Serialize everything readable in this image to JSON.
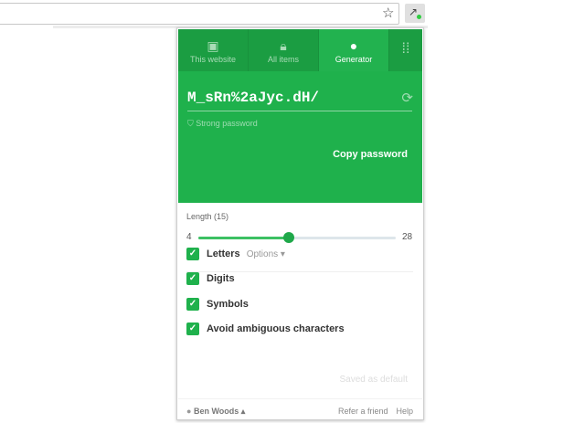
{
  "browser": {
    "bookmark_icon": "star-icon",
    "extension_icon": "password-manager-extension-icon"
  },
  "tabs": [
    {
      "label": "This website",
      "icon": "website-icon"
    },
    {
      "label": "All items",
      "icon": "lock-icon"
    },
    {
      "label": "Generator",
      "icon": "generator-icon",
      "active": true
    },
    {
      "label": "",
      "icon": "apps-grid-icon"
    }
  ],
  "generator": {
    "password": "M_sRn%2aJyc.dH/",
    "strength": "Strong password",
    "copy_label": "Copy password",
    "length_label": "Length (15)",
    "length": 15,
    "min": "4",
    "max": "28",
    "options": [
      {
        "label": "Letters",
        "checked": true,
        "extra": "Options ▾"
      },
      {
        "label": "Digits",
        "checked": true
      },
      {
        "label": "Symbols",
        "checked": true
      },
      {
        "label": "Avoid ambiguous characters",
        "checked": true
      }
    ],
    "saved_label": "Saved as default"
  },
  "footer": {
    "user": "Ben Woods ▴",
    "refer": "Refer a friend",
    "help": "Help"
  },
  "colors": {
    "brand": "#1fb14c"
  }
}
